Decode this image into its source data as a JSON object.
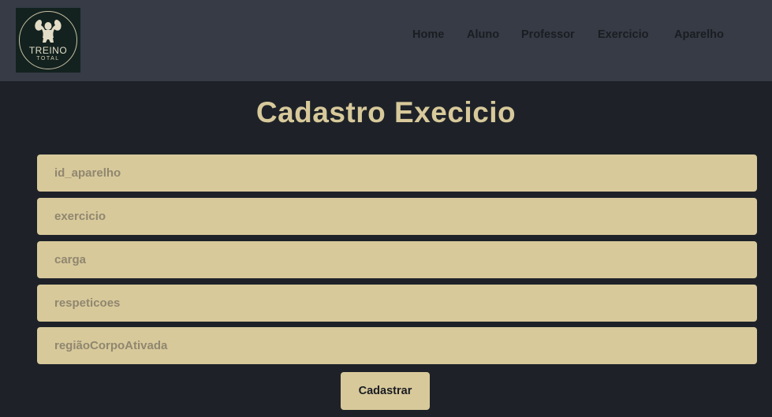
{
  "logo": {
    "word": "TREINO",
    "sub": "TOTAL"
  },
  "nav": {
    "items": [
      {
        "label": "Home"
      },
      {
        "label": "Aluno"
      },
      {
        "label": "Professor"
      },
      {
        "label": "Exercicio"
      },
      {
        "label": "Aparelho"
      }
    ]
  },
  "page": {
    "title": "Cadastro Execicio"
  },
  "form": {
    "fields": [
      {
        "placeholder": "id_aparelho",
        "value": ""
      },
      {
        "placeholder": "exercicio",
        "value": ""
      },
      {
        "placeholder": "carga",
        "value": ""
      },
      {
        "placeholder": "respeticoes",
        "value": ""
      },
      {
        "placeholder": "regiãoCorpoAtivada",
        "value": ""
      }
    ],
    "submit_label": "Cadastrar"
  },
  "colors": {
    "header_bg": "#363b45",
    "page_bg": "#1e2228",
    "accent": "#d8c99b",
    "text_dark": "#1a1d22"
  }
}
